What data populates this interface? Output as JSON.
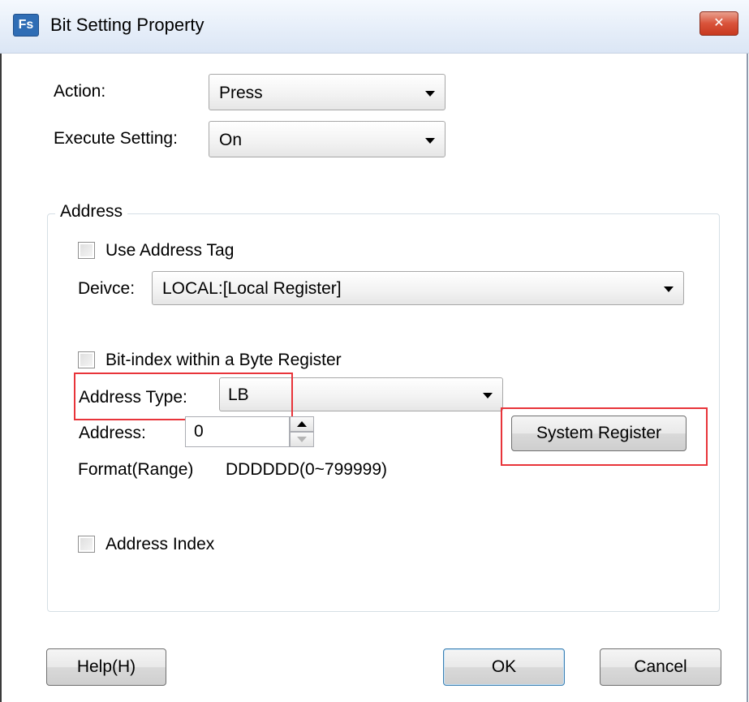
{
  "window": {
    "title": "Bit Setting Property",
    "app_icon_text": "Fs",
    "close_symbol": "✕"
  },
  "action": {
    "label": "Action:",
    "value": "Press"
  },
  "execute_setting": {
    "label": "Execute Setting:",
    "value": "On"
  },
  "address_group": {
    "title": "Address",
    "use_address_tag": {
      "label": "Use Address Tag",
      "checked": false
    },
    "device": {
      "label": "Deivce:",
      "value": "LOCAL:[Local Register]"
    },
    "bit_index": {
      "label": "Bit-index within a Byte Register",
      "checked": false
    },
    "address_type": {
      "label": "Address Type:",
      "value": "LB"
    },
    "address": {
      "label": "Address:",
      "value": "0"
    },
    "system_register_button": "System Register",
    "format": {
      "label": "Format(Range)",
      "value": "DDDDDD(0~799999)"
    },
    "address_index": {
      "label": "Address Index",
      "checked": false
    }
  },
  "buttons": {
    "help": "Help(H)",
    "ok": "OK",
    "cancel": "Cancel"
  },
  "colors": {
    "highlight": "#e8343a",
    "close_button": "#d9533a"
  }
}
